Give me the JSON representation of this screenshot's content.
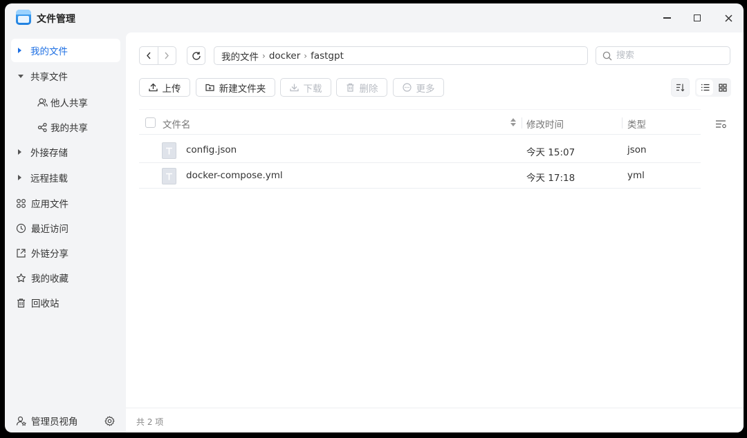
{
  "app": {
    "title": "文件管理"
  },
  "sidebar": {
    "items": [
      {
        "label": "我的文件",
        "active": true
      },
      {
        "label": "共享文件"
      },
      {
        "label": "他人共享"
      },
      {
        "label": "我的共享"
      },
      {
        "label": "外接存储"
      },
      {
        "label": "远程挂载"
      },
      {
        "label": "应用文件"
      },
      {
        "label": "最近访问"
      },
      {
        "label": "外链分享"
      },
      {
        "label": "我的收藏"
      },
      {
        "label": "回收站"
      }
    ],
    "bottom": {
      "label": "管理员视角"
    }
  },
  "breadcrumb": [
    "我的文件",
    "docker",
    "fastgpt"
  ],
  "search": {
    "placeholder": "搜索"
  },
  "toolbar": {
    "upload": "上传",
    "new_folder": "新建文件夹",
    "download": "下载",
    "delete": "删除",
    "more": "更多"
  },
  "table": {
    "columns": {
      "name": "文件名",
      "modified": "修改时间",
      "type": "类型"
    },
    "rows": [
      {
        "name": "config.json",
        "modified": "今天 15:07",
        "type": "json"
      },
      {
        "name": "docker-compose.yml",
        "modified": "今天 17:18",
        "type": "yml"
      }
    ]
  },
  "footer": {
    "count": "共 2 项"
  },
  "colors": {
    "accent": "#1d6fe3",
    "sidebar_bg": "#f3f4f6"
  }
}
